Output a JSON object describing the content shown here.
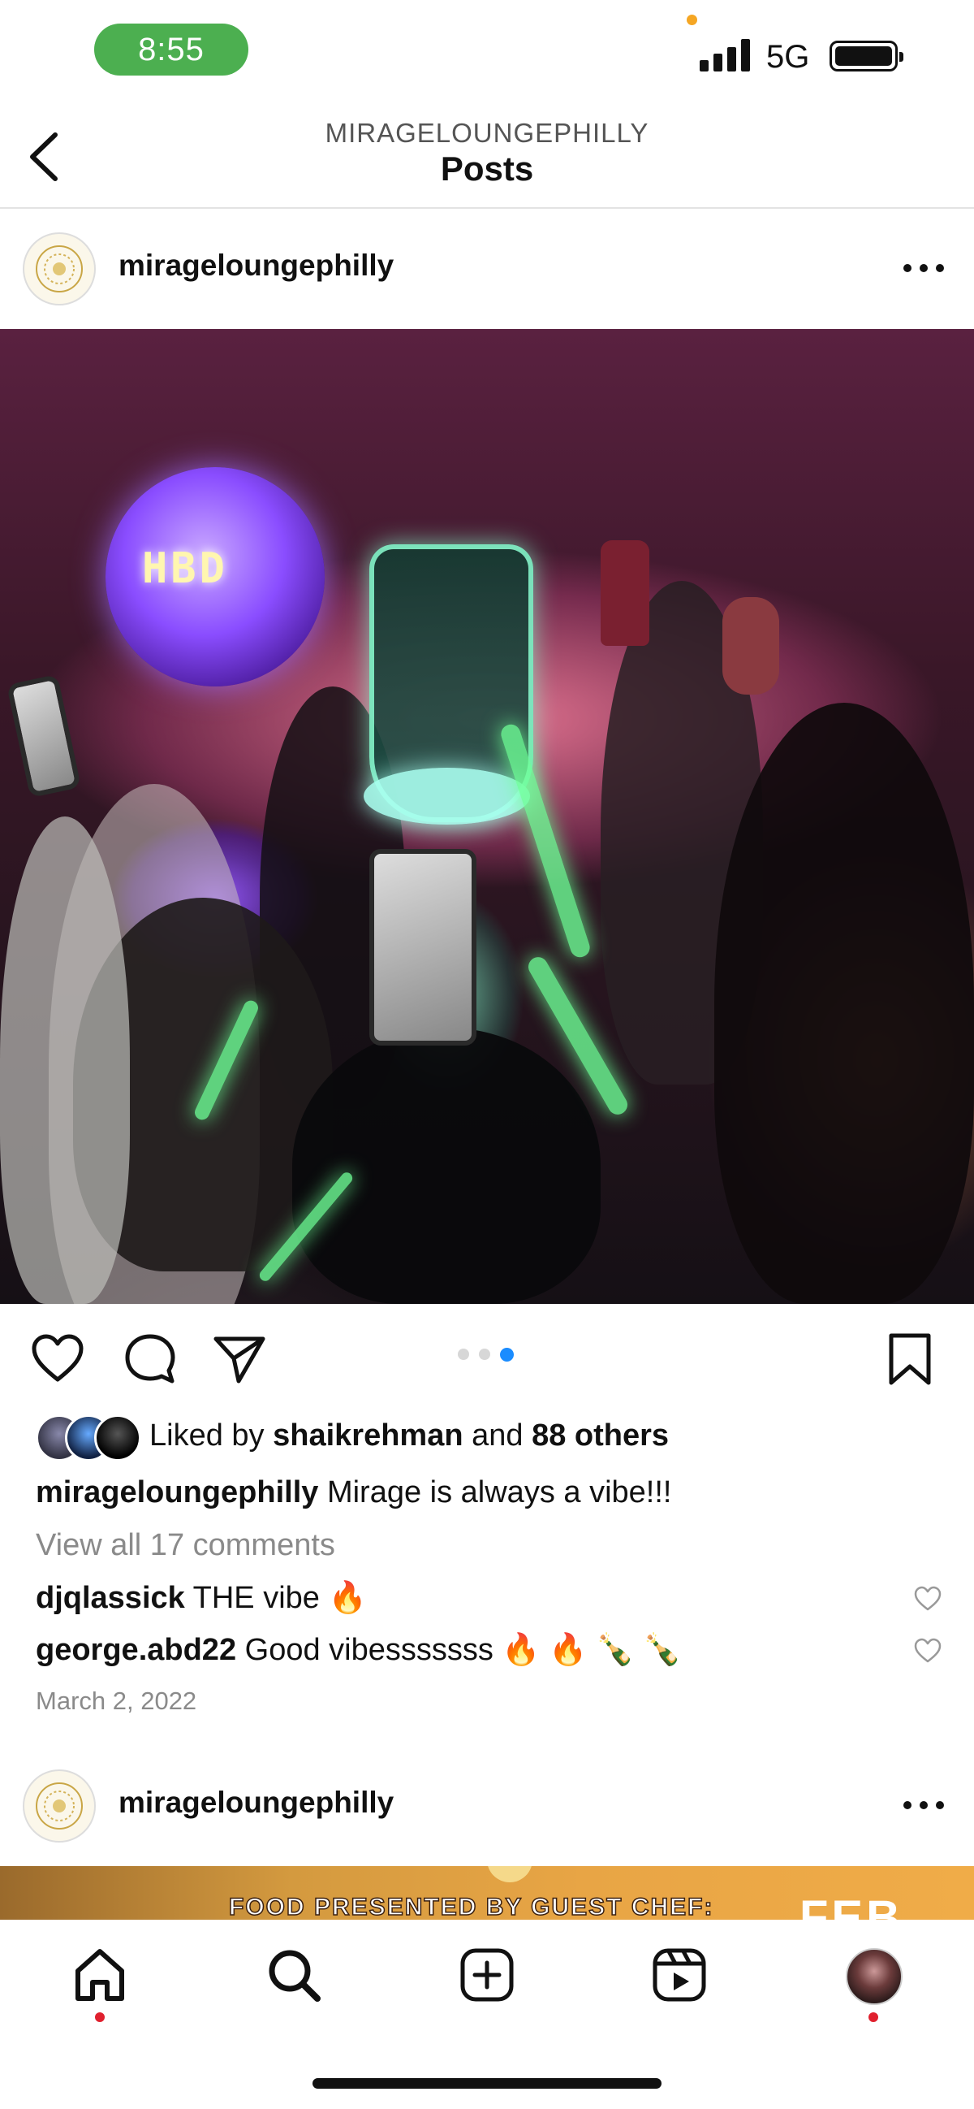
{
  "status_bar": {
    "time": "8:55",
    "network": "5G"
  },
  "header": {
    "account": "MIRAGELOUNGEPHILLY",
    "title": "Posts"
  },
  "post": {
    "username": "mirageloungephilly",
    "carousel": {
      "count": 3,
      "active_index": 2
    },
    "photo_text": "HBD",
    "likes": {
      "prefix": "Liked by",
      "first_user": "shaikrehman",
      "conjunction": "and",
      "others": "88 others"
    },
    "caption": {
      "user": "mirageloungephilly",
      "text": "Mirage is always a vibe!!!"
    },
    "view_comments": "View all 17 comments",
    "comments": [
      {
        "user": "djqlassick",
        "text": "THE vibe 🔥"
      },
      {
        "user": "george.abd22",
        "text": "Good vibesssssss 🔥 🔥 🍾 🍾"
      }
    ],
    "date": "March 2, 2022"
  },
  "next_post": {
    "username": "mirageloungephilly",
    "banner_text": "FOOD PRESENTED BY GUEST CHEF:",
    "banner_partial": "FEB"
  },
  "nav": [
    "home-icon",
    "search-icon",
    "create-post-icon",
    "reels-icon",
    "profile-avatar"
  ],
  "colors": {
    "accent_blue": "#1a8cff",
    "notification_red": "#e0202e",
    "time_pill_green": "#4caf50"
  }
}
